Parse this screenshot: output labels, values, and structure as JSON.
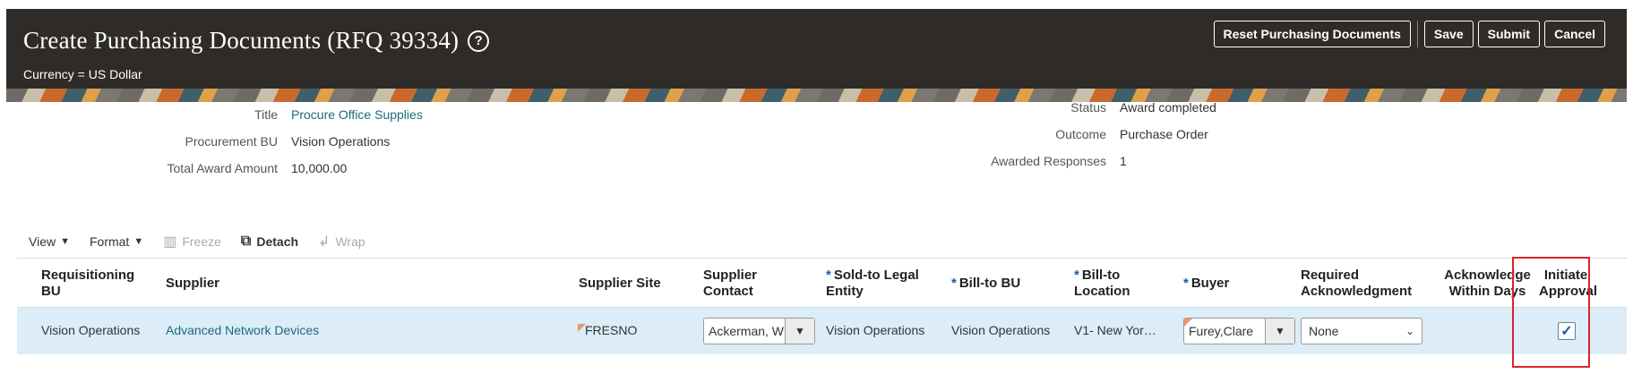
{
  "header": {
    "title": "Create Purchasing Documents (RFQ 39334)",
    "help_icon": "?",
    "currency": "Currency = US Dollar",
    "buttons": {
      "reset": "Reset Purchasing Documents",
      "save": "Save",
      "submit": "Submit",
      "cancel": "Cancel"
    }
  },
  "summary": {
    "left": [
      {
        "label": "Title",
        "value": "Procure Office Supplies"
      },
      {
        "label": "Procurement BU",
        "value": "Vision Operations"
      },
      {
        "label": "Total Award Amount",
        "value": "10,000.00"
      }
    ],
    "right": [
      {
        "label": "Status",
        "value": "Award completed"
      },
      {
        "label": "Outcome",
        "value": "Purchase Order"
      },
      {
        "label": "Awarded Responses",
        "value": "1"
      }
    ]
  },
  "toolbar": {
    "view": "View",
    "format": "Format",
    "freeze": "Freeze",
    "detach": "Detach",
    "wrap": "Wrap"
  },
  "table": {
    "columns": {
      "req_bu": "Requisitioning BU",
      "supplier": "Supplier",
      "supplier_site": "Supplier Site",
      "supplier_contact": "Supplier Contact",
      "sold_to": "Sold-to Legal Entity",
      "bill_to_bu": "Bill-to BU",
      "bill_to_location": "Bill-to Location",
      "buyer": "Buyer",
      "required_ack": "Required Acknowledgment",
      "ack_within_days": "Acknowledge Within Days",
      "initiate_approval": "Initiate Approval"
    },
    "row": {
      "req_bu": "Vision Operations",
      "supplier": "Advanced Network Devices",
      "supplier_site": "FRESNO",
      "supplier_contact": "Ackerman, W",
      "sold_to": "Vision Operations",
      "bill_to_bu": "Vision Operations",
      "bill_to_location": "V1- New Yor…",
      "buyer": "Furey,Clare",
      "required_ack": "None",
      "ack_within_days": "",
      "initiate_approval": true
    }
  },
  "colors": {
    "header_bg": "#2f2b28",
    "link": "#1a6b7a",
    "row_selected": "#dcedf8",
    "required_star": "#1a5aa6",
    "highlight": "#d6262a"
  }
}
